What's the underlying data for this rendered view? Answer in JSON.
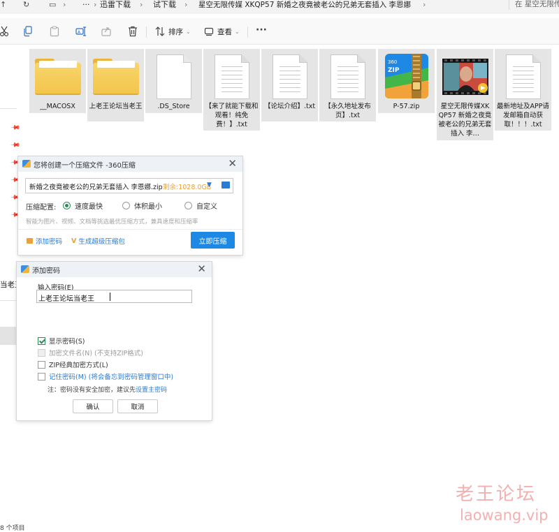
{
  "addressbar": {
    "segments": [
      "迅雷下载",
      "试下载",
      "星空无限传媒 XKQP57 新婚之夜竟被老公的兄弟无套插入 李恩娜"
    ],
    "search_placeholder": "在 星空无限传媒"
  },
  "toolbar": {
    "sort_label": "排序",
    "view_label": "查看",
    "more_label": "···"
  },
  "files": [
    {
      "name": "__MACOSX",
      "type": "folder"
    },
    {
      "name": "上老王论坛当老王",
      "type": "folder"
    },
    {
      "name": ".DS_Store",
      "type": "blank"
    },
    {
      "name": "【来了就能下载和观看！纯免费！】.txt",
      "type": "txt"
    },
    {
      "name": "【论坛介绍】.txt",
      "type": "txt"
    },
    {
      "name": "【永久地址发布页】.txt",
      "type": "txt"
    },
    {
      "name": "P-57.zip",
      "type": "zip"
    },
    {
      "name": "星空无限传媒XKQP57 新婚之夜竟被老公的兄弟无套插入 李…",
      "type": "video"
    },
    {
      "name": "最新地址及APP请发邮箱自动获取！！！.txt",
      "type": "txt"
    }
  ],
  "sidebar": {
    "partial_label": "当老王",
    "status": "8 个项目"
  },
  "compress_dialog": {
    "title": "您将创建一个压缩文件 -360压缩",
    "filename": "新婚之夜竟被老公的兄弟无套插入 李恩娜.zip",
    "free_space": "剩余:1028.0GB",
    "config_label": "压缩配置:",
    "options": [
      "速度最快",
      "体积最小",
      "自定义"
    ],
    "selected_option": "速度最快",
    "hint": "智能为图片、视频、文档等挑选最优压缩方式，兼具速度和压缩率",
    "add_password": "添加密码",
    "super_pack": "生成超级压缩包",
    "compress_button": "立即压缩"
  },
  "password_dialog": {
    "title": "添加密码",
    "input_label": "输入密码(E)",
    "password_value": "上老王论坛当老王",
    "show_password": "显示密码(S)",
    "encrypt_names": "加密文件名(N) (不支持ZIP格式)",
    "zip_classic": "ZIP经典加密方式(L)",
    "remember": "记住密码(M) (将会备忘到密码管理窗口中)",
    "note": "注：密码没有安全加密，建议先",
    "note_link": "设置主密码",
    "ok_button": "确认",
    "cancel_button": "取消"
  },
  "watermark": {
    "cn": "老王论坛",
    "url": "laowang.vip"
  },
  "colors": {
    "accent_blue": "#1e88e5",
    "checkbox_green": "#2f8a5a",
    "link_blue": "#2a7bd3",
    "orange": "#e9a23b",
    "watermark": "#f3b0b0"
  }
}
